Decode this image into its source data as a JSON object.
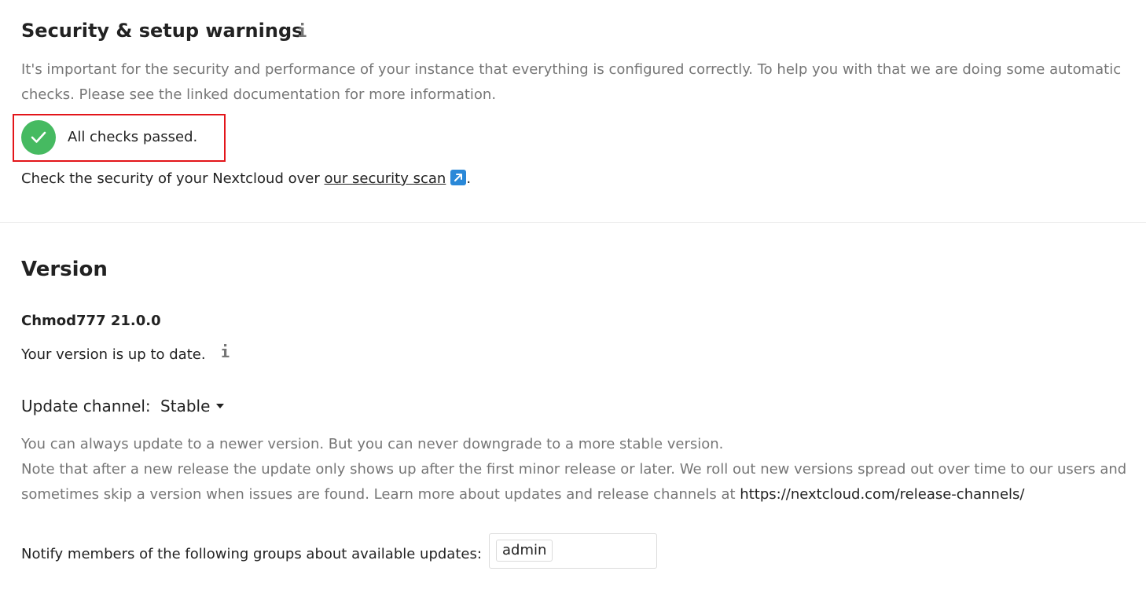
{
  "security": {
    "heading": "Security & setup warnings",
    "info_icon": "info-icon",
    "description_line1": "It's important for the security and performance of your instance that everything is configured correctly. To help you with that we are doing some automatic",
    "description_line2": "checks. Please see the linked documentation for more information.",
    "status_icon": "check-circle-icon",
    "status_text": "All checks passed.",
    "scan_prefix": "Check the security of your Nextcloud over ",
    "scan_link_label": "our security scan",
    "scan_link_icon": "external-link-icon",
    "scan_suffix": ".",
    "colors": {
      "success": "#46ba61",
      "highlight_border": "#e3151a",
      "link_badge": "#2a88d8"
    }
  },
  "version": {
    "heading": "Version",
    "name": "Chmod777 21.0.0",
    "status_text": "Your version is up to date.",
    "info_icon": "info-icon",
    "channel_label": "Update channel:",
    "channel_value": "Stable",
    "channel_icon": "caret-down-icon",
    "note_line1": "You can always update to a newer version. But you can never downgrade to a more stable version.",
    "note_line2": "Note that after a new release the update only shows up after the first minor release or later. We roll out new versions spread out over time to our users and",
    "note_line3_prefix": "sometimes skip a version when issues are found. Learn more about updates and release channels at ",
    "note_line3_url": "https://nextcloud.com/release-channels/",
    "notify_label": "Notify members of the following groups about available updates:",
    "notify_groups": [
      "admin"
    ]
  }
}
